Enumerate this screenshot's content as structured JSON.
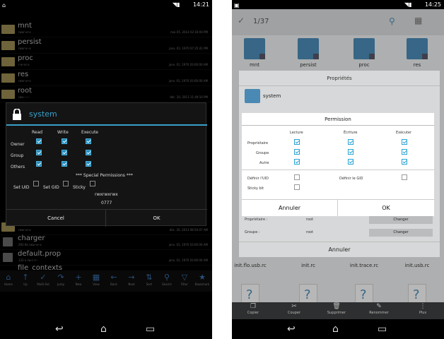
{
  "left": {
    "status_time": "14:21",
    "list": [
      {
        "name": "mnt",
        "sub": "rwxr-xr-x",
        "date": "mai 05, 2014 02:18:00 PM"
      },
      {
        "name": "persist",
        "sub": "rwxr-x--x",
        "date": "janv. 01, 1970 07:25:41 PM"
      },
      {
        "name": "proc",
        "sub": "r-xr-xr-x",
        "date": "janv. 01, 1970 03:00:00 AM"
      },
      {
        "name": "res",
        "sub": "rwxr-xr-x",
        "date": "janv. 01, 1970 03:00:00 AM"
      },
      {
        "name": "root",
        "sub": "rwx------",
        "date": "déc. 20, 2013 11:49:10 PM"
      }
    ],
    "list_bottom": [
      {
        "name": "",
        "sub": "rwxr-xr-x",
        "date": "déc. 20, 2013 08:50:07 AM"
      },
      {
        "name": "charger",
        "sub": "292 Ko rwxr-xr-x",
        "date": "janv. 01, 1970 03:00:00 AM"
      },
      {
        "name": "default.prop",
        "sub": "132 o rw-r--r--",
        "date": "janv. 01, 1970 03:00:00 AM"
      },
      {
        "name": "file_contexts",
        "sub": "",
        "date": ""
      }
    ],
    "dialog": {
      "title": "system",
      "col_read": "Read",
      "col_write": "Write",
      "col_execute": "Execute",
      "row_owner": "Owner",
      "row_group": "Group",
      "row_others": "Others",
      "special_header": "*** Special Permissions ***",
      "set_uid": "Set UID",
      "set_gid": "Set GID",
      "sticky": "Sticky",
      "perm_string": "rwxrwxrwx",
      "perm_octal": "0777",
      "cancel": "Cancel",
      "ok": "OK"
    },
    "toolbar": [
      "Home",
      "Up",
      "Multi-Sel",
      "Jump",
      "New",
      "View",
      "Back",
      "Next",
      "Sort",
      "Search",
      "Filter",
      "Bookmark"
    ]
  },
  "right": {
    "status_time": "14:25",
    "top_counter": "1/37",
    "top_grid": [
      "mnt",
      "persist",
      "proc",
      "res"
    ],
    "props_title": "Propriétés",
    "props_folder": "system",
    "owner_label": "Propriétaire :",
    "owner_value": "root",
    "group_label": "Groupe :",
    "group_value": "root",
    "change1": "Changer",
    "change2": "Changer",
    "props_cancel": "Annuler",
    "perm": {
      "title": "Permission",
      "col_read": "Lecture",
      "col_write": "Écriture",
      "col_execute": "Exécuter",
      "row_owner": "Propriétaire",
      "row_group": "Groupe",
      "row_others": "Autre",
      "set_uid": "Définir l'UID",
      "set_gid": "Définir le GID",
      "sticky": "Sticky bit",
      "cancel": "Annuler",
      "ok": "OK"
    },
    "bottom_grid": [
      "init.flo.usb.rc",
      "init.rc",
      "init.trace.rc",
      "init.usb.rc"
    ],
    "bottom_toolbar": [
      "Copier",
      "Couper",
      "Supprimer",
      "Renommer",
      "Plus"
    ]
  }
}
